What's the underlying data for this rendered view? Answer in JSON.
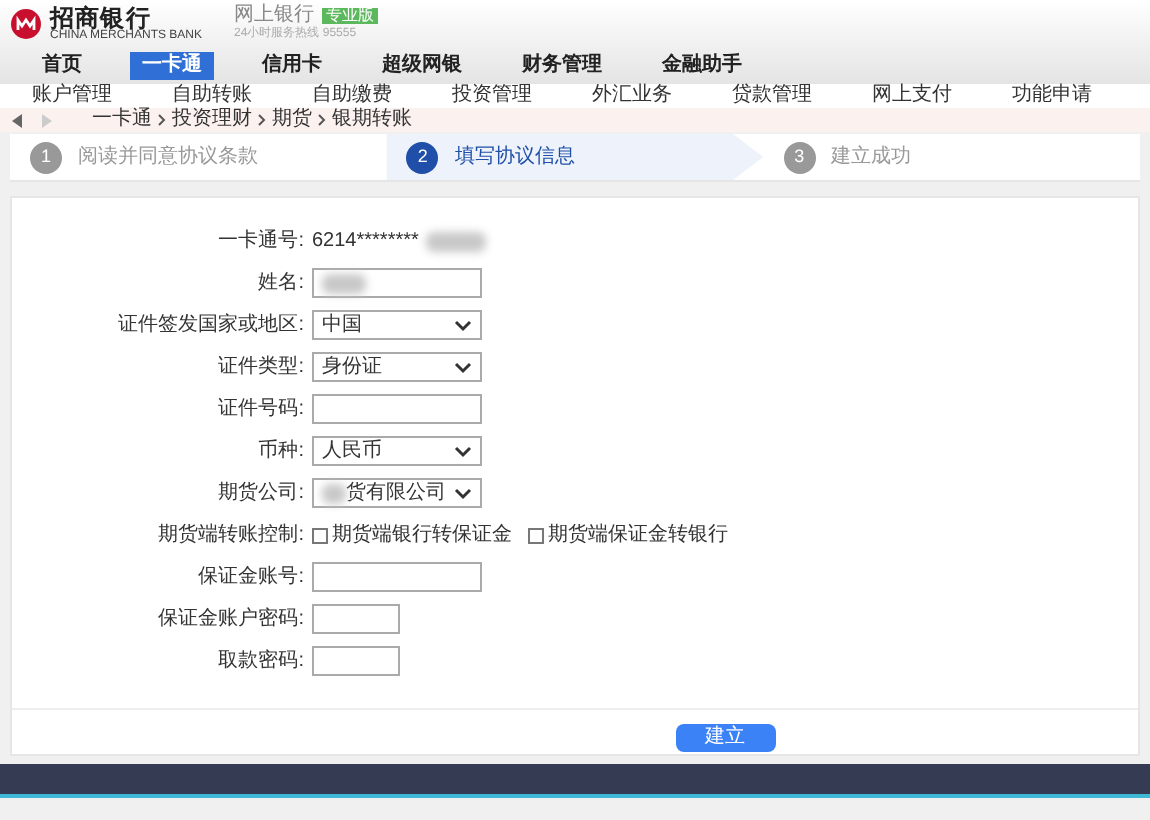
{
  "header": {
    "bank_name": "招商银行",
    "bank_name_en": "CHINA MERCHANTS BANK",
    "product": "网上银行",
    "badge": "专业版",
    "hotline": "24小时服务热线 95555"
  },
  "nav": [
    {
      "label": "首页",
      "selected": false
    },
    {
      "label": "一卡通",
      "selected": true
    },
    {
      "label": "信用卡",
      "selected": false
    },
    {
      "label": "超级网银",
      "selected": false
    },
    {
      "label": "财务管理",
      "selected": false
    },
    {
      "label": "金融助手",
      "selected": false
    }
  ],
  "subnav": [
    "账户管理",
    "自助转账",
    "自助缴费",
    "投资管理",
    "外汇业务",
    "贷款管理",
    "网上支付",
    "功能申请"
  ],
  "breadcrumb": [
    "一卡通",
    "投资理财",
    "期货",
    "银期转账"
  ],
  "steps": [
    {
      "number": "1",
      "label": "阅读并同意协议条款",
      "selected": false
    },
    {
      "number": "2",
      "label": "填写协议信息",
      "selected": true
    },
    {
      "number": "3",
      "label": "建立成功",
      "selected": false
    }
  ],
  "form": [
    {
      "kind": "text",
      "label": "一卡通号:",
      "value": "6214********",
      "redacted": true
    },
    {
      "kind": "input",
      "label": "姓名:",
      "redacted": true
    },
    {
      "kind": "select",
      "label": "证件签发国家或地区:",
      "value": "中国"
    },
    {
      "kind": "select",
      "label": "证件类型:",
      "value": "身份证"
    },
    {
      "kind": "input",
      "label": "证件号码:",
      "redacted": false
    },
    {
      "kind": "select",
      "label": "币种:",
      "value": "人民币"
    },
    {
      "kind": "select",
      "label": "期货公司:",
      "value": "货有限公司",
      "redacted": true
    },
    {
      "kind": "checks",
      "label": "期货端转账控制:",
      "options": [
        {
          "label": "期货端银行转保证金",
          "checked": false
        },
        {
          "label": "期货端保证金转银行",
          "checked": false
        }
      ]
    },
    {
      "kind": "input",
      "label": "保证金账号:",
      "redacted": false
    },
    {
      "kind": "password",
      "label": "保证金账户密码:",
      "redacted": false
    },
    {
      "kind": "password",
      "label": "取款密码:",
      "redacted": false
    }
  ],
  "submit": "建立"
}
